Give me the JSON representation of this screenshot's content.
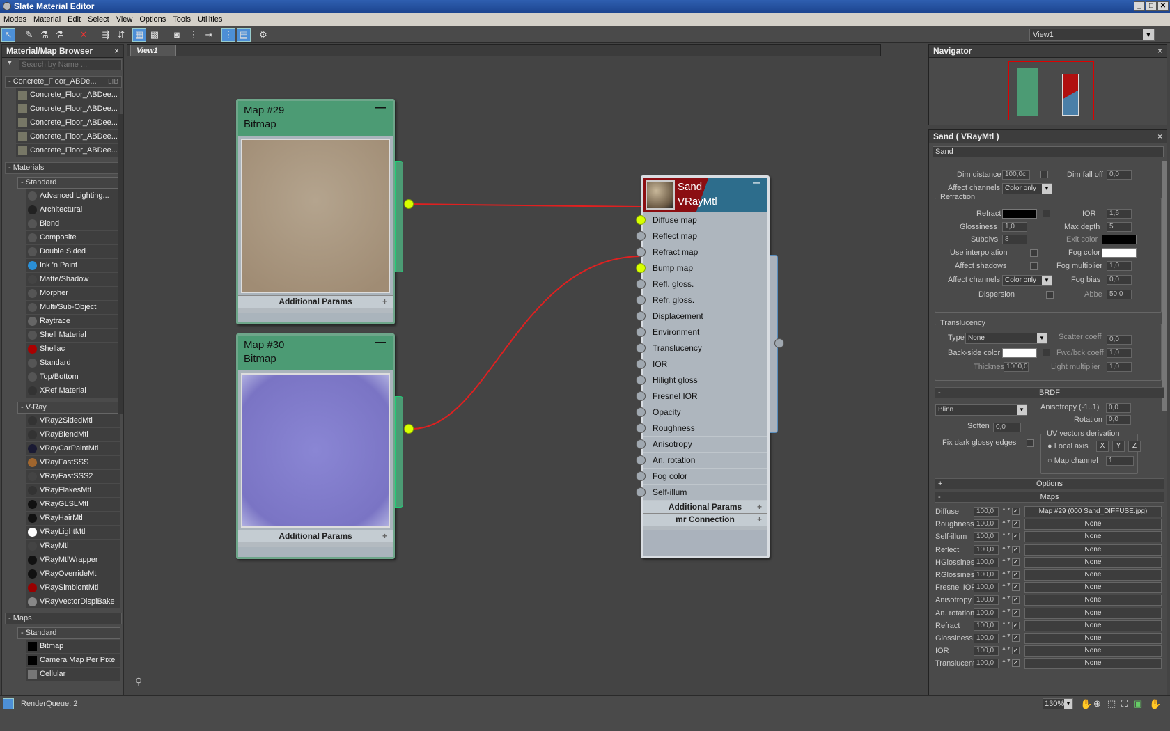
{
  "app": {
    "title": "Slate Material Editor"
  },
  "menu": [
    "Modes",
    "Material",
    "Edit",
    "Select",
    "View",
    "Options",
    "Tools",
    "Utilities"
  ],
  "view_selector": "View1",
  "browser": {
    "title": "Material/Map Browser",
    "search_placeholder": "Search by Name ...",
    "library": {
      "name": "Concrete_Floor_ABDe...",
      "tag": "LIB",
      "items": [
        "Concrete_Floor_ABDee...",
        "Concrete_Floor_ABDee...",
        "Concrete_Floor_ABDee...",
        "Concrete_Floor_ABDee...",
        "Concrete_Floor_ABDee..."
      ]
    },
    "materials_label": "Materials",
    "standard_label": "Standard",
    "standard_items": [
      "Advanced Lighting...",
      "Architectural",
      "Blend",
      "Composite",
      "Double Sided",
      "Ink 'n Paint",
      "Matte/Shadow",
      "Morpher",
      "Multi/Sub-Object",
      "Raytrace",
      "Shell Material",
      "Shellac",
      "Standard",
      "Top/Bottom",
      "XRef Material"
    ],
    "vray_label": "V-Ray",
    "vray_items": [
      "VRay2SidedMtl",
      "VRayBlendMtl",
      "VRayCarPaintMtl",
      "VRayFastSSS",
      "VRayFastSSS2",
      "VRayFlakesMtl",
      "VRayGLSLMtl",
      "VRayHairMtl",
      "VRayLightMtl",
      "VRayMtl",
      "VRayMtlWrapper",
      "VRayOverrideMtl",
      "VRaySimbiontMtl",
      "VRayVectorDisplBake"
    ],
    "maps_label": "Maps",
    "maps_standard_label": "Standard",
    "map_items": [
      "Bitmap",
      "Camera Map Per Pixel",
      "Cellular"
    ]
  },
  "view_tab": "View1",
  "nodes": {
    "map29": {
      "name": "Map #29",
      "type": "Bitmap",
      "params": "Additional Params"
    },
    "map30": {
      "name": "Map #30",
      "type": "Bitmap",
      "params": "Additional Params"
    },
    "sand": {
      "name": "Sand",
      "type": "VRayMtl",
      "slots": [
        "Diffuse map",
        "Reflect map",
        "Refract map",
        "Bump map",
        "Refl. gloss.",
        "Refr. gloss.",
        "Displacement",
        "Environment",
        "Translucency",
        "IOR",
        "Hilight gloss",
        "Fresnel IOR",
        "Opacity",
        "Roughness",
        "Anisotropy",
        "An. rotation",
        "Fog color",
        "Self-illum"
      ],
      "params": "Additional Params",
      "mr": "mr Connection"
    }
  },
  "navigator": {
    "title": "Navigator"
  },
  "props": {
    "title": "Sand  ( VRayMtl )",
    "name": "Sand",
    "dim_distance_label": "Dim distance",
    "dim_distance": "100,0c",
    "dim_falloff_label": "Dim fall off",
    "dim_falloff": "0,0",
    "affect_channels_label": "Affect channels",
    "affect_channels": "Color only",
    "refraction_label": "Refraction",
    "refract_label": "Refract",
    "ior_label": "IOR",
    "ior": "1,6",
    "glossiness_label": "Glossiness",
    "glossiness": "1,0",
    "max_depth_label": "Max depth",
    "max_depth": "5",
    "subdivs_label": "Subdivs",
    "subdivs": "8",
    "exit_color_label": "Exit color",
    "use_interp_label": "Use interpolation",
    "fog_color_label": "Fog color",
    "affect_shadows_label": "Affect shadows",
    "fog_mult_label": "Fog multiplier",
    "fog_mult": "1,0",
    "affect_channels2": "Color only",
    "fog_bias_label": "Fog bias",
    "fog_bias": "0,0",
    "dispersion_label": "Dispersion",
    "abbe_label": "Abbe",
    "abbe": "50,0",
    "translucency_label": "Translucency",
    "type_label": "Type",
    "type_value": "None",
    "scatter_label": "Scatter coeff",
    "scatter": "0,0",
    "backside_label": "Back-side color",
    "fwdbck_label": "Fwd/bck coeff",
    "fwdbck": "1,0",
    "thickness_label": "Thickness",
    "thickness": "1000,0",
    "light_mult_label": "Light multiplier",
    "light_mult": "1,0",
    "brdf_label": "BRDF",
    "brdf_type": "Blinn",
    "anisotropy_label": "Anisotropy (-1..1)",
    "anisotropy": "0,0",
    "rotation_label": "Rotation",
    "rotation": "0,0",
    "soften_label": "Soften",
    "soften": "0,0",
    "uv_label": "UV vectors derivation",
    "local_axis_label": "Local axis",
    "x": "X",
    "y": "Y",
    "z": "Z",
    "fix_dark_label": "Fix dark glossy edges",
    "map_channel_label": "Map channel",
    "map_channel": "1",
    "options_label": "Options",
    "maps_label": "Maps",
    "maps": [
      {
        "name": "Diffuse",
        "amount": "100,0",
        "map": "Map #29 (000 Sand_DIFFUSE.jpg)"
      },
      {
        "name": "Roughness",
        "amount": "100,0",
        "map": "None"
      },
      {
        "name": "Self-illum",
        "amount": "100,0",
        "map": "None"
      },
      {
        "name": "Reflect",
        "amount": "100,0",
        "map": "None"
      },
      {
        "name": "HGlossiness",
        "amount": "100,0",
        "map": "None"
      },
      {
        "name": "RGlossiness",
        "amount": "100,0",
        "map": "None"
      },
      {
        "name": "Fresnel IOR",
        "amount": "100,0",
        "map": "None"
      },
      {
        "name": "Anisotropy",
        "amount": "100,0",
        "map": "None"
      },
      {
        "name": "An. rotation",
        "amount": "100,0",
        "map": "None"
      },
      {
        "name": "Refract",
        "amount": "100,0",
        "map": "None"
      },
      {
        "name": "Glossiness",
        "amount": "100,0",
        "map": "None"
      },
      {
        "name": "IOR",
        "amount": "100,0",
        "map": "None"
      },
      {
        "name": "Translucent",
        "amount": "100,0",
        "map": "None"
      }
    ]
  },
  "status": {
    "render_queue": "RenderQueue: 2",
    "zoom": "130%"
  },
  "colors": {
    "accent": "#4d8fd6",
    "node_green": "#4c9b74",
    "wire": "#e02020",
    "socket_active": "#d8ff00"
  }
}
